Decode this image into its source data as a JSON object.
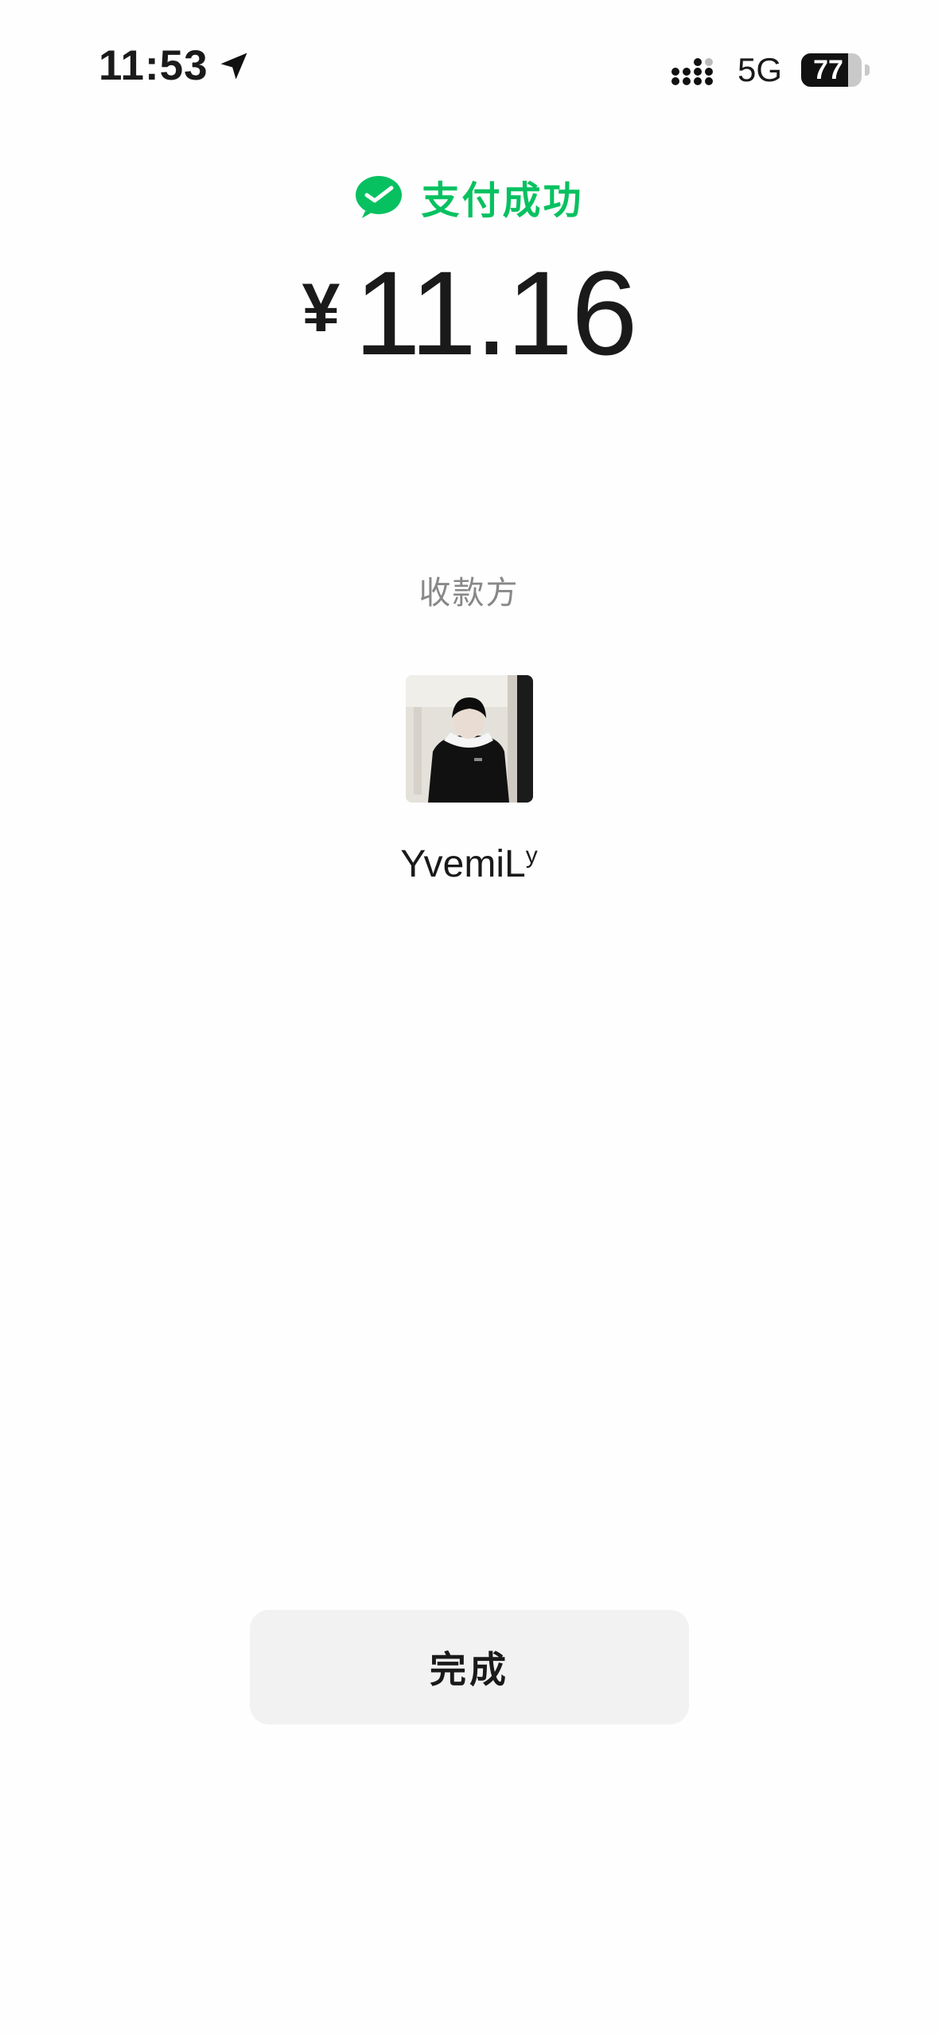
{
  "status_bar": {
    "time": "11:53",
    "network": "5G",
    "battery_percent": "77",
    "icons": [
      "location-arrow-icon",
      "signal-bars-icon",
      "battery-icon"
    ]
  },
  "payment": {
    "status_text": "支付成功",
    "status_icon": "wechat-pay-check-icon",
    "currency_symbol": "¥",
    "amount": "11.16",
    "accent_color": "#07c160"
  },
  "payee": {
    "label": "收款方",
    "name": "YvemiL",
    "name_superscript": "y",
    "avatar": "payee-avatar"
  },
  "actions": {
    "done_label": "完成"
  }
}
